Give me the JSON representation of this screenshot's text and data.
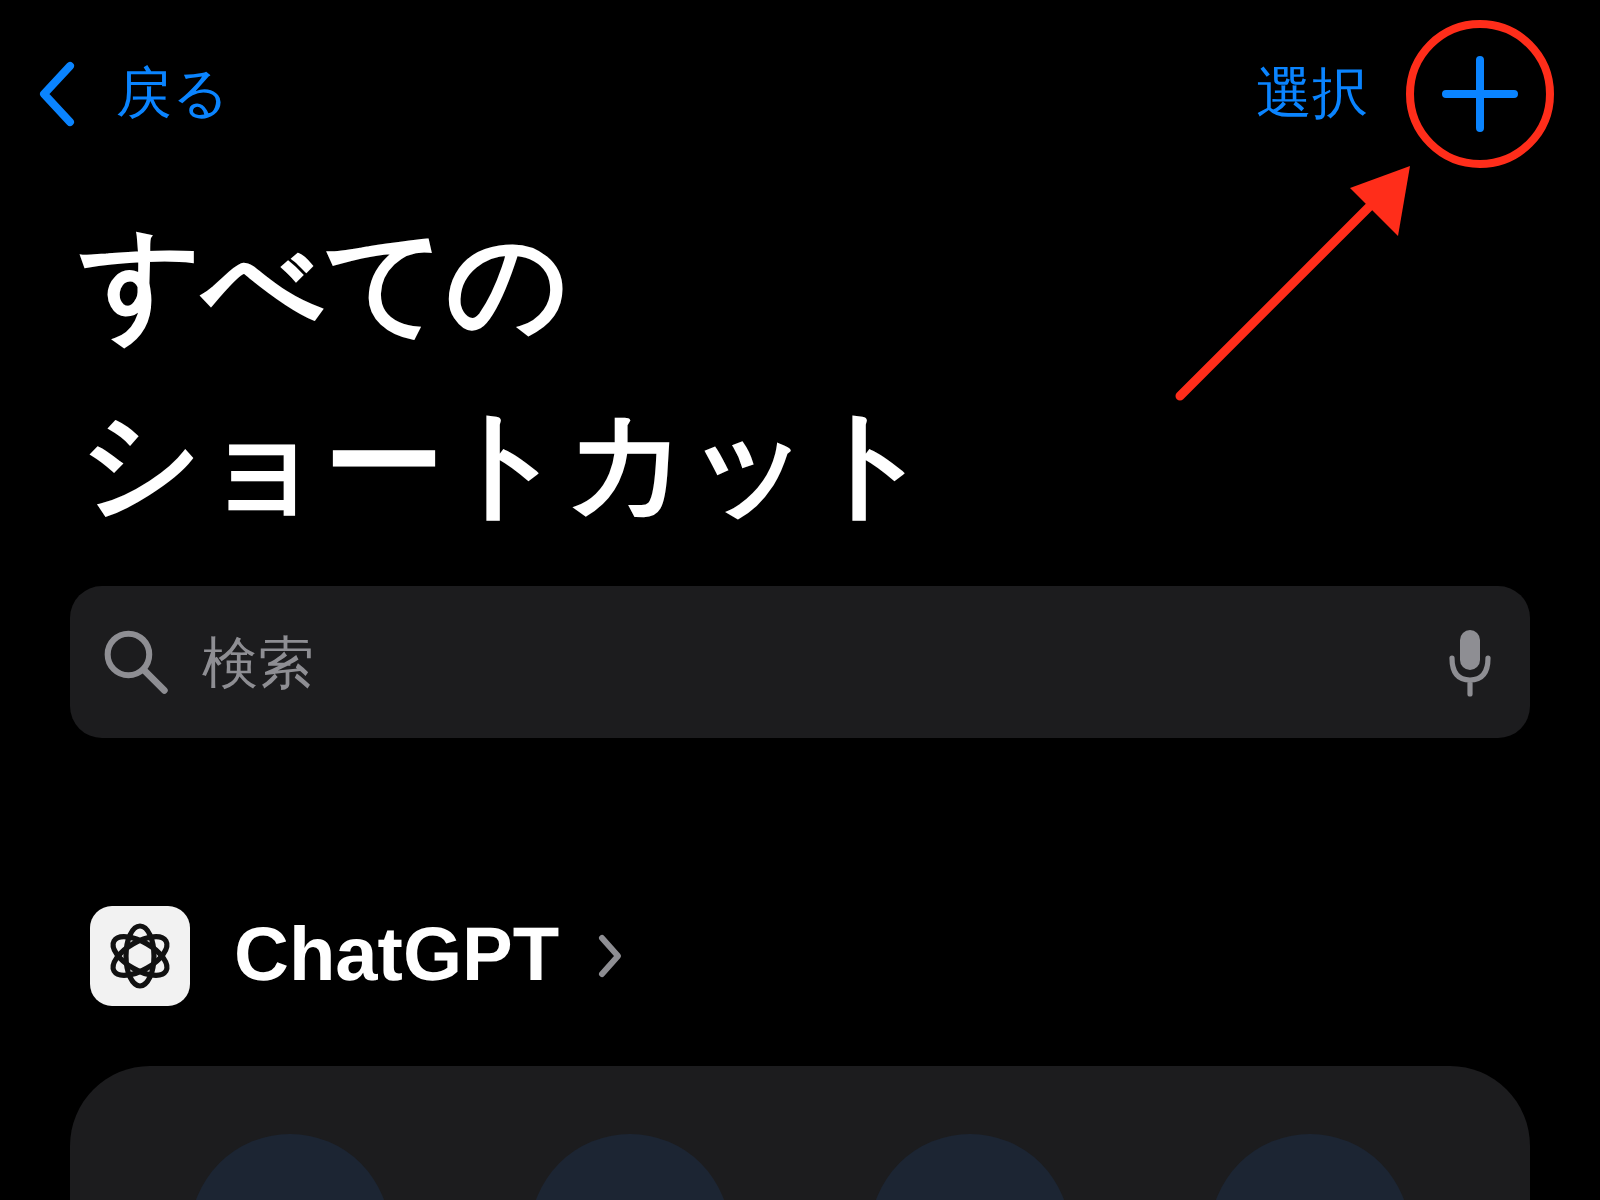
{
  "nav": {
    "back_label": "戻る",
    "select_label": "選択"
  },
  "title_lines": [
    "すべての",
    "ショートカット"
  ],
  "search": {
    "placeholder": "検索"
  },
  "section": {
    "title": "ChatGPT"
  }
}
